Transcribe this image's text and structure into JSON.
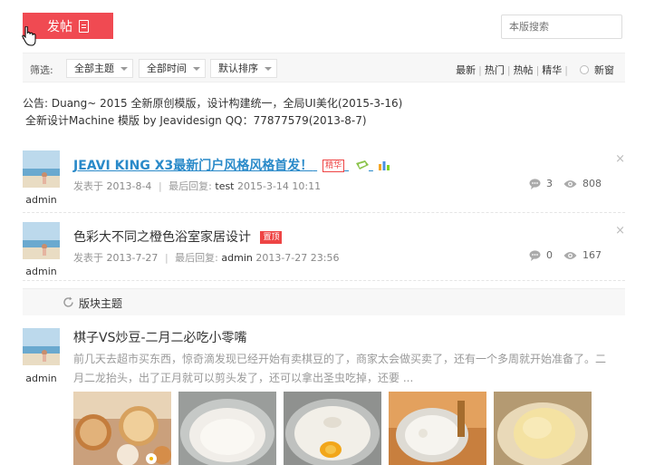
{
  "toolbar": {
    "post_label": "发帖",
    "search_placeholder": "本版搜索"
  },
  "filter": {
    "label": "筛选:",
    "theme": "全部主题",
    "time": "全部时间",
    "sort": "默认排序",
    "links": [
      "最新",
      "热门",
      "热帖",
      "精华"
    ],
    "new_window": "新窗"
  },
  "announcement": {
    "line1": "公告:    Duang~    2015 全新原创模版，设计构建统一，全局UI美化(2015-3-16)",
    "line2": "全新设计Machine  模版  by Jeavidesign QQ：77877579(2013-8-7)"
  },
  "threads": [
    {
      "author": "admin",
      "title": "JEAVI KING X3最新门户风格风格首发！",
      "badge": "精华",
      "posted_label": "发表于",
      "posted": "2013-8-4",
      "reply_label": "最后回复:",
      "reply_user": "test",
      "reply_time": "2015-3-14 10:11",
      "comments": "3",
      "views": "808"
    },
    {
      "author": "admin",
      "title": "色彩大不同之橙色浴室家居设计",
      "badge": "置顶",
      "posted_label": "发表于",
      "posted": "2013-7-27",
      "reply_label": "最后回复:",
      "reply_user": "admin",
      "reply_time": "2013-7-27 23:56",
      "comments": "0",
      "views": "167"
    }
  ],
  "board_section": {
    "label": "版块主题"
  },
  "featured": {
    "author": "admin",
    "title": "棋子VS炒豆-二月二必吃小零嘴",
    "excerpt_line1": "前几天去超市买东西，惊奇滴发现已经开始有卖棋豆的了，商家太会做买卖了，还有一个多周就开始准备了。二",
    "excerpt_line2": "月二龙抬头，出了正月就可以剪头发了，还可以拿出圣虫吃掉，还要  ..."
  },
  "colors": {
    "accent": "#f04a52",
    "link": "#2a8ac9",
    "badge": "#e44444"
  }
}
